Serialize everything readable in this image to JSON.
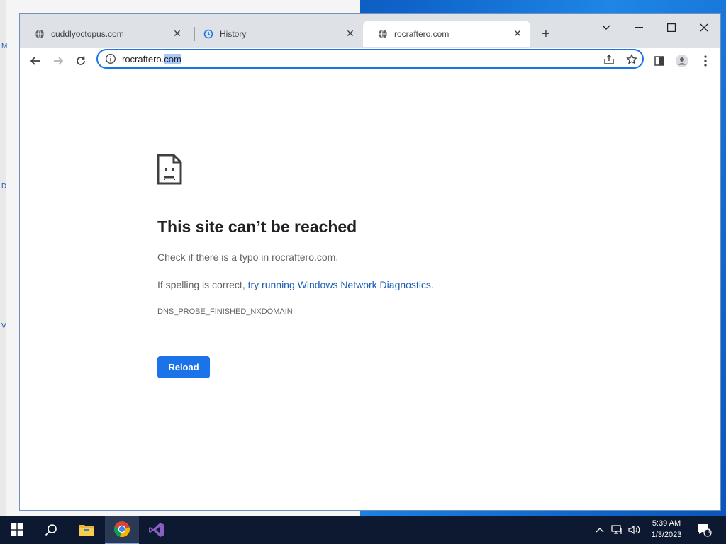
{
  "tabs": [
    {
      "title": "cuddlyoctopus.com",
      "active": false,
      "icon": "globe-icon"
    },
    {
      "title": "History",
      "active": false,
      "icon": "history-icon"
    },
    {
      "title": "rocraftero.com",
      "active": true,
      "icon": "globe-icon"
    }
  ],
  "window_controls": [
    "tab-search",
    "minimize",
    "maximize",
    "close"
  ],
  "address_bar": {
    "url_prefix": "rocraftero.",
    "url_selected": "com"
  },
  "error_page": {
    "title": "This site can’t be reached",
    "line1": "Check if there is a typo in rocraftero.com.",
    "line2_prefix": "If spelling is correct, ",
    "line2_link": "try running Windows Network Diagnostics",
    "line2_suffix": ".",
    "error_code": "DNS_PROBE_FINISHED_NXDOMAIN",
    "reload_label": "Reload"
  },
  "desktop": {
    "bg_letters": [
      "M",
      "D",
      "V"
    ]
  },
  "taskbar": {
    "items": [
      "windows-start-icon",
      "search-icon",
      "file-explorer-icon",
      "chrome-icon",
      "visual-studio-icon"
    ],
    "time": "5:39 AM",
    "date": "1/3/2023",
    "notification_count": "1"
  },
  "colors": {
    "accent": "#1a73e8",
    "link": "#1a5fb4",
    "tabstrip": "#dee1e6",
    "taskbar": "#0d1930"
  }
}
